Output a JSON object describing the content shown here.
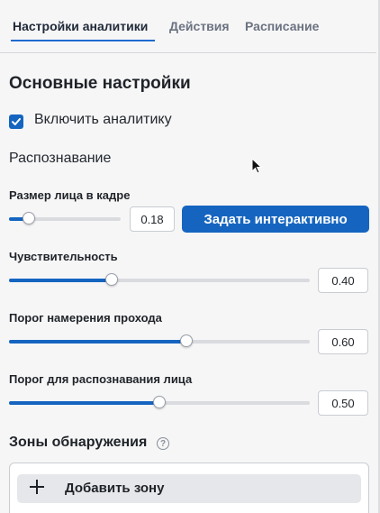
{
  "tabs": [
    {
      "label": "Настройки аналитики",
      "active": true
    },
    {
      "label": "Действия",
      "active": false
    },
    {
      "label": "Расписание",
      "active": false
    }
  ],
  "main": {
    "section_title": "Основные настройки",
    "enable_analytics": {
      "label": "Включить аналитику",
      "checked": true
    },
    "recognition_label": "Распознавание",
    "face_size": {
      "label": "Размер лица в кадре",
      "value": "0.18",
      "level": 0.18,
      "button_label": "Задать интерактивно"
    },
    "sensitivity": {
      "label": "Чувствительность",
      "value": "0.40",
      "level": 0.34
    },
    "pass_threshold": {
      "label": "Порог намерения прохода",
      "value": "0.60",
      "level": 0.59
    },
    "face_threshold": {
      "label": "Порог для распознавания лица",
      "value": "0.50",
      "level": 0.5
    }
  },
  "zones": {
    "title": "Зоны обнаружения",
    "help_icon": "?",
    "add_label": "Добавить зону"
  },
  "colors": {
    "accent": "#1565c0",
    "track": "#d9dbdf",
    "background": "#f6f6f7"
  }
}
